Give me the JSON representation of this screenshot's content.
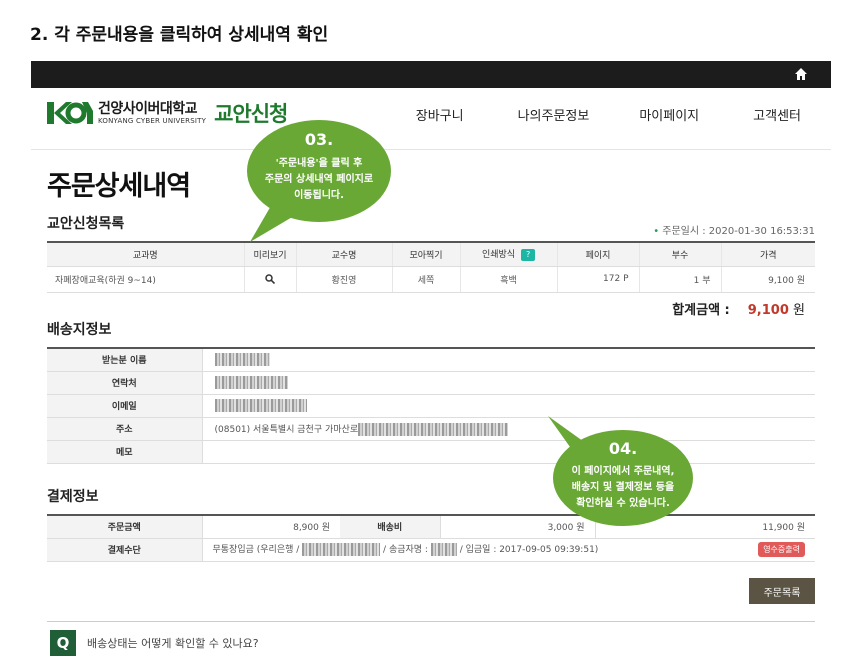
{
  "instruction": "2. 각 주문내용을 클릭하여 상세내역 확인",
  "header": {
    "logo_ko": "건양사이버대학교",
    "logo_en": "KONYANG CYBER UNIVERSITY",
    "logo_sub": "교안신청",
    "nav": [
      "장바구니",
      "나의주문정보",
      "마이페이지",
      "고객센터"
    ]
  },
  "page_title": "주문상세내역",
  "order_section": {
    "title": "교안신청목록",
    "order_date": "주문일시 : 2020-01-30 16:53:31",
    "columns": [
      "교과명",
      "미리보기",
      "교수명",
      "모아찍기",
      "인쇄방식",
      "페이지",
      "부수",
      "가격"
    ],
    "help_badge": "?",
    "row": {
      "course": "자폐장애교육(하권 9~14)",
      "professor": "황진영",
      "layout": "세쪽",
      "print": "흑백",
      "pages": "172 P",
      "copies": "1 부",
      "price": "9,100 원"
    },
    "total_label": "합계금액 :",
    "total_amount": "9,100",
    "total_unit": "원"
  },
  "shipping": {
    "title": "배송지정보",
    "labels": [
      "받는분 이름",
      "연락처",
      "이메일",
      "주소",
      "메모"
    ],
    "address": "(08501) 서울특별시 금천구 가마산로"
  },
  "payment": {
    "title": "결제정보",
    "order_amount_label": "주문금액",
    "order_amount": "8,900 원",
    "shipping_fee_label": "배송비",
    "shipping_fee": "3,000 원",
    "total": "11,900 원",
    "method_label": "결제수단",
    "method_prefix": "무통장입금 (우리은행 /",
    "sender_label": "/ 송금자명 :",
    "deposit_date": "/ 입금일 : 2017-09-05 09:39:51)",
    "receipt_button": "영수증출력"
  },
  "list_button": "주문목록",
  "faq_q": "Q",
  "faq_text": "배송상태는 어떻게 확인할 수 있나요?",
  "callout1": {
    "num": "03.",
    "line1": "'주문내용'을 클릭 후",
    "line2": "주문의 상세내역  페이지로",
    "line3": "이동됩니다."
  },
  "callout2": {
    "num": "04.",
    "line1": "이 페이지에서 주문내역,",
    "line2": "배송지 및 결제정보 등을",
    "line3": "확인하실 수 있습니다."
  },
  "colors": {
    "callout_green": "#6aa836",
    "brand_green": "#1f7a2e",
    "accent_red": "#c0392b"
  }
}
